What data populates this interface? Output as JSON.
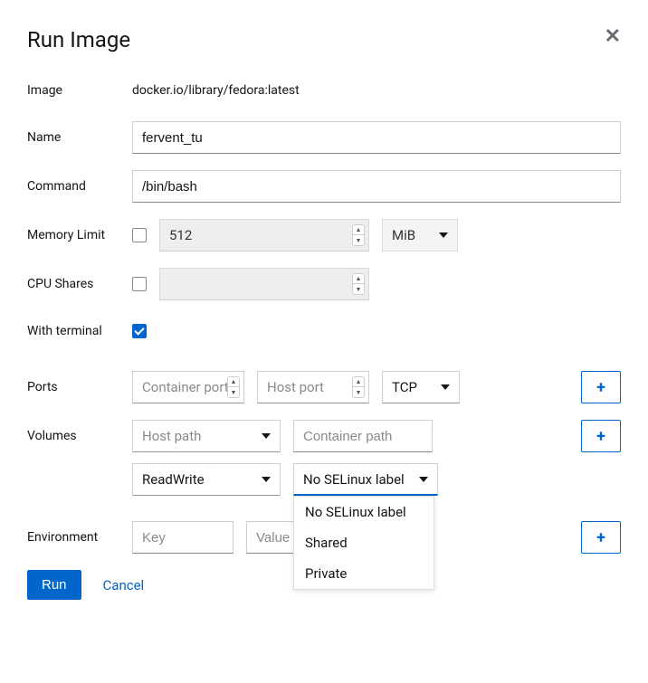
{
  "title": "Run Image",
  "labels": {
    "image": "Image",
    "name": "Name",
    "command": "Command",
    "memory": "Memory Limit",
    "cpu": "CPU Shares",
    "terminal": "With terminal",
    "ports": "Ports",
    "volumes": "Volumes",
    "env": "Environment"
  },
  "values": {
    "image": "docker.io/library/fedora:latest",
    "name": "fervent_tu",
    "command": "/bin/bash",
    "memory": "512",
    "memory_unit": "MiB",
    "cpu": "",
    "port_proto": "TCP",
    "vol_mode": "ReadWrite",
    "selinux": "No SELinux label"
  },
  "placeholders": {
    "container_port": "Container port",
    "host_port": "Host port",
    "host_path": "Host path",
    "container_path": "Container path",
    "env_key": "Key",
    "env_value": "Value"
  },
  "selinux_options": [
    "No SELinux label",
    "Shared",
    "Private"
  ],
  "buttons": {
    "run": "Run",
    "cancel": "Cancel"
  }
}
